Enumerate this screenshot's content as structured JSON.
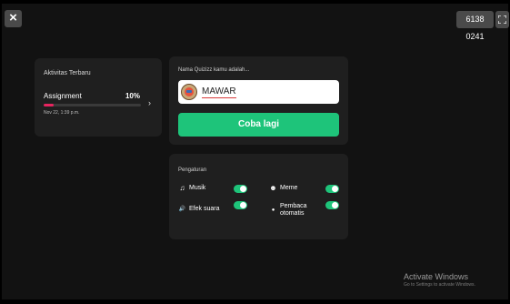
{
  "topbar": {
    "close_label": "×",
    "game_code": "6138 0241"
  },
  "activity": {
    "title": "Aktivitas Terbaru",
    "item_label": "Assignment",
    "item_percent_label": "10%",
    "progress_fraction": 0.1,
    "item_date": "Nov 22, 1:39 p.m.",
    "chevron": "›"
  },
  "name_card": {
    "prompt": "Nama Quizizz kamu adalah...",
    "name_value": "MAWAR",
    "retry_label": "Coba lagi"
  },
  "settings": {
    "title": "Pengaturan",
    "items": [
      {
        "label": "Musik",
        "icon": "♫",
        "enabled": true
      },
      {
        "label": "Meme",
        "icon": "☻",
        "enabled": true
      },
      {
        "label": "Efek suara",
        "icon": "🔊",
        "enabled": true
      },
      {
        "label": "Pembaca otomatis",
        "icon": "●",
        "enabled": true
      }
    ]
  },
  "watermark": {
    "title": "Activate Windows",
    "subtitle": "Go to Settings to activate Windows."
  },
  "colors": {
    "accent_green": "#1ec47a",
    "progress_pink": "#e8245f",
    "card_bg": "#1f1f1f"
  }
}
